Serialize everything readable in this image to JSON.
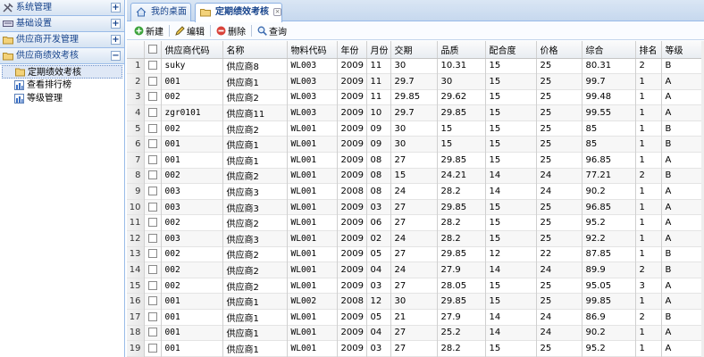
{
  "sidebar": {
    "sections": [
      {
        "title": "系统管理",
        "toggle": "+"
      },
      {
        "title": "基础设置",
        "toggle": "+"
      },
      {
        "title": "供应商开发管理",
        "toggle": "+"
      },
      {
        "title": "供应商绩效考核",
        "toggle": "−",
        "items": [
          "定期绩效考核",
          "查看排行榜",
          "等级管理"
        ]
      }
    ]
  },
  "tabs": [
    {
      "label": "我的桌面"
    },
    {
      "label": "定期绩效考核",
      "close": "×"
    }
  ],
  "toolbar": {
    "new_label": "新建",
    "edit_label": "编辑",
    "delete_label": "删除",
    "search_label": "查询"
  },
  "grid": {
    "columns": [
      "供应商代码",
      "名称",
      "物料代码",
      "年份",
      "月份",
      "交期",
      "品质",
      "配合度",
      "价格",
      "综合",
      "排名",
      "等级"
    ],
    "rows": [
      [
        "1",
        "suky",
        "供应商8",
        "WL003",
        "2009",
        "11",
        "30",
        "10.31",
        "15",
        "25",
        "80.31",
        "2",
        "B"
      ],
      [
        "2",
        "001",
        "供应商1",
        "WL003",
        "2009",
        "11",
        "29.7",
        "30",
        "15",
        "25",
        "99.7",
        "1",
        "A"
      ],
      [
        "3",
        "002",
        "供应商2",
        "WL003",
        "2009",
        "11",
        "29.85",
        "29.62",
        "15",
        "25",
        "99.48",
        "1",
        "A"
      ],
      [
        "4",
        "zgr0101",
        "供应商11",
        "WL003",
        "2009",
        "10",
        "29.7",
        "29.85",
        "15",
        "25",
        "99.55",
        "1",
        "A"
      ],
      [
        "5",
        "002",
        "供应商2",
        "WL001",
        "2009",
        "09",
        "30",
        "15",
        "15",
        "25",
        "85",
        "1",
        "B"
      ],
      [
        "6",
        "001",
        "供应商1",
        "WL001",
        "2009",
        "09",
        "30",
        "15",
        "15",
        "25",
        "85",
        "1",
        "B"
      ],
      [
        "7",
        "001",
        "供应商1",
        "WL001",
        "2009",
        "08",
        "27",
        "29.85",
        "15",
        "25",
        "96.85",
        "1",
        "A"
      ],
      [
        "8",
        "002",
        "供应商2",
        "WL001",
        "2009",
        "08",
        "15",
        "24.21",
        "14",
        "24",
        "77.21",
        "2",
        "B"
      ],
      [
        "9",
        "003",
        "供应商3",
        "WL001",
        "2008",
        "08",
        "24",
        "28.2",
        "14",
        "24",
        "90.2",
        "1",
        "A"
      ],
      [
        "10",
        "003",
        "供应商3",
        "WL001",
        "2009",
        "03",
        "27",
        "29.85",
        "15",
        "25",
        "96.85",
        "1",
        "A"
      ],
      [
        "11",
        "002",
        "供应商2",
        "WL001",
        "2009",
        "06",
        "27",
        "28.2",
        "15",
        "25",
        "95.2",
        "1",
        "A"
      ],
      [
        "12",
        "003",
        "供应商3",
        "WL001",
        "2009",
        "02",
        "24",
        "28.2",
        "15",
        "25",
        "92.2",
        "1",
        "A"
      ],
      [
        "13",
        "002",
        "供应商2",
        "WL001",
        "2009",
        "05",
        "27",
        "29.85",
        "12",
        "22",
        "87.85",
        "1",
        "B"
      ],
      [
        "14",
        "002",
        "供应商2",
        "WL001",
        "2009",
        "04",
        "24",
        "27.9",
        "14",
        "24",
        "89.9",
        "2",
        "B"
      ],
      [
        "15",
        "002",
        "供应商2",
        "WL001",
        "2009",
        "03",
        "27",
        "28.05",
        "15",
        "25",
        "95.05",
        "3",
        "A"
      ],
      [
        "16",
        "001",
        "供应商1",
        "WL002",
        "2008",
        "12",
        "30",
        "29.85",
        "15",
        "25",
        "99.85",
        "1",
        "A"
      ],
      [
        "17",
        "001",
        "供应商1",
        "WL001",
        "2009",
        "05",
        "21",
        "27.9",
        "14",
        "24",
        "86.9",
        "2",
        "B"
      ],
      [
        "18",
        "001",
        "供应商1",
        "WL001",
        "2009",
        "04",
        "27",
        "25.2",
        "14",
        "24",
        "90.2",
        "1",
        "A"
      ],
      [
        "19",
        "001",
        "供应商1",
        "WL001",
        "2009",
        "03",
        "27",
        "28.2",
        "15",
        "25",
        "95.2",
        "1",
        "A"
      ]
    ]
  }
}
